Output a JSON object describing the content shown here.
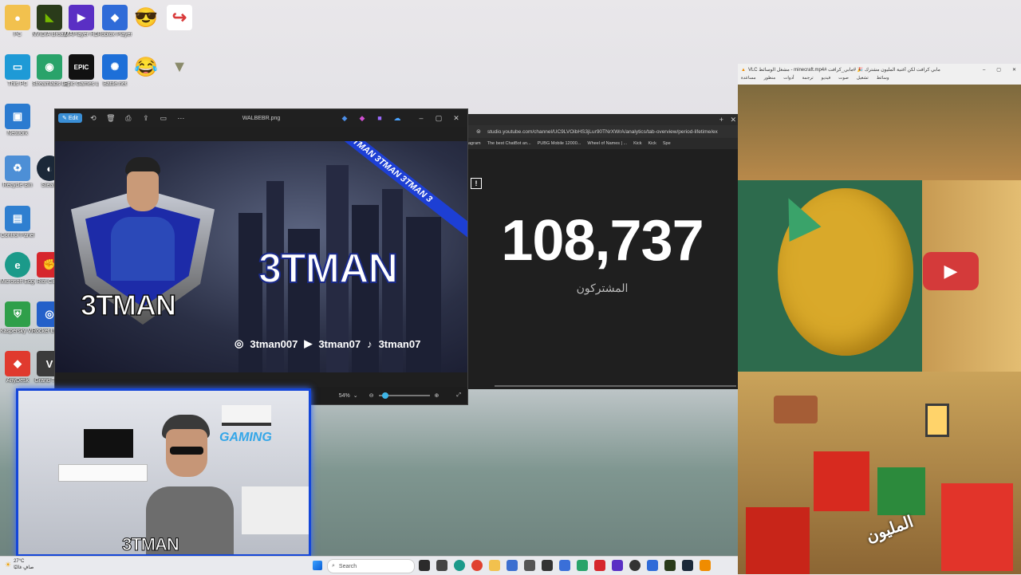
{
  "desktop": {
    "icons": [
      {
        "label": "PC",
        "color": "#f2c14e"
      },
      {
        "label": "NVIDIA Broadcast",
        "color": "#2a3b1a"
      },
      {
        "label": "MAPlayer HD",
        "color": "#5a2fc4"
      },
      {
        "label": "Roblox Player",
        "color": "#2f6bd8"
      },
      {
        "label": "",
        "color": "#f7c948"
      },
      {
        "label": "",
        "color": "#d93b3b"
      },
      {
        "label": "This PC",
        "color": "#1e9ad6"
      },
      {
        "label": "Streamlabs Desktop",
        "color": "#29a36a"
      },
      {
        "label": "Epic Games Launcher",
        "color": "#111111"
      },
      {
        "label": "Battle.net",
        "color": "#1d6fd8"
      },
      {
        "label": "",
        "color": "#f7c948"
      },
      {
        "label": "",
        "color": "#8a8a6a"
      },
      {
        "label": "Network",
        "color": "#2b7bd0"
      },
      {
        "label": "Recycle Bin",
        "color": "#4d8fd6"
      },
      {
        "label": "Control Panel",
        "color": "#2f7fd0"
      },
      {
        "label": "Microsoft Edge",
        "color": "#1b9a8a"
      },
      {
        "label": "Kaspersky VPN",
        "color": "#2f9f4a"
      },
      {
        "label": "AnyDesk",
        "color": "#e03a2e"
      },
      {
        "label": "Steam",
        "color": "#1b2838"
      },
      {
        "label": "Riot Client",
        "color": "#d6262c"
      },
      {
        "label": "Rocket League",
        "color": "#2460c9"
      },
      {
        "label": "Grand Theft",
        "color": "#3b3b3b"
      }
    ]
  },
  "photos": {
    "edit_label": "Edit",
    "filename": "WALBEBR.png",
    "zoom": "54%",
    "banner": {
      "name_main": "3TMAN",
      "name_logo": "3TMAN",
      "ribbon": "MAN 3TMAN 3TMAN 3TMAN 3",
      "socials": [
        {
          "icon": "instagram-icon",
          "handle": "3tman007"
        },
        {
          "icon": "youtube-icon",
          "handle": "3tman07"
        },
        {
          "icon": "tiktok-icon",
          "handle": "3tman07"
        }
      ]
    }
  },
  "browser": {
    "url": "studio.youtube.com/channel/UC9LVOibHS3jLur90TNrXWrA/analytics/tab-overview/period-lifetime/ex",
    "bookmarks": [
      "agram",
      "The best ChatBot an...",
      "PUBG Mobile 12000...",
      "Wheel of Names | ...",
      "Kick",
      "Kick",
      "Spe"
    ],
    "subscriber_count": "108,737",
    "subscriber_label": "المشتركون"
  },
  "vlc": {
    "title": "VLC مشغل الوسائط - minecraft.mp4# مابي كرافت لكن أغنية المليون مشترك 🎉 #مابي_كرافت",
    "menu": [
      "وسائط",
      "تشغيل",
      "صوت",
      "فيديو",
      "ترجمة",
      "أدوات",
      "منظور",
      "مساعدة"
    ],
    "video_caption": "المليون"
  },
  "webcam": {
    "overlay_name": "3TMAN",
    "wall_text": "GAMING"
  },
  "taskbar": {
    "weather_temp": "27°C",
    "weather_desc": "صافٍ غالبًا",
    "search_placeholder": "Search"
  }
}
